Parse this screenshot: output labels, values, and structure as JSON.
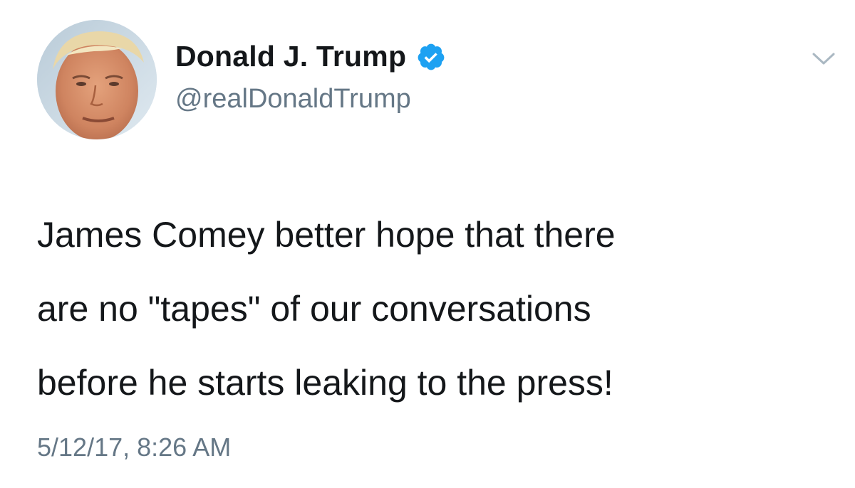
{
  "tweet": {
    "author": {
      "display_name": "Donald J. Trump",
      "handle": "@realDonaldTrump",
      "verified": true
    },
    "text": "James Comey better hope that there\nare no \"tapes\" of our conversations\nbefore he starts leaking to the press!",
    "timestamp": "5/12/17, 8:26 AM"
  },
  "icons": {
    "verified": "verified-badge-icon",
    "menu": "chevron-down-icon"
  },
  "colors": {
    "verified_blue": "#1da1f2",
    "text_primary": "#14171a",
    "text_secondary": "#657786",
    "chevron": "#aab8c2"
  }
}
